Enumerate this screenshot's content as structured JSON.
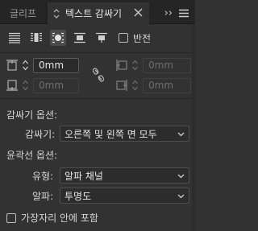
{
  "tabs": [
    {
      "label": "글리프"
    },
    {
      "label": "텍스트 감싸기"
    }
  ],
  "panel_menu": {
    "expand_label": "››"
  },
  "wrap_options_row": {
    "invert_label": "반전",
    "invert_checked": false
  },
  "offsets": {
    "top": {
      "value": "0mm"
    },
    "bottom": {
      "value": "0mm"
    },
    "left": {
      "value": "0mm",
      "enabled": false
    },
    "right": {
      "value": "0mm",
      "enabled": false
    }
  },
  "wrap_options": {
    "heading": "감싸기 옵션:",
    "wrap_to_label": "감싸기:",
    "wrap_to_value": "오른쪽 및 왼쪽 면 모두"
  },
  "contour_options": {
    "heading": "윤곽선 옵션:",
    "type_label": "유형:",
    "type_value": "알파 채널",
    "alpha_label": "알파:",
    "alpha_value": "투명도"
  },
  "include_inside_edges": {
    "label": "가장자리 안에 포함",
    "checked": false
  },
  "colors": {
    "panel_bg": "#323232",
    "tab_bar_bg": "#252525",
    "selected_icon_bg": "#4a4a4a"
  }
}
